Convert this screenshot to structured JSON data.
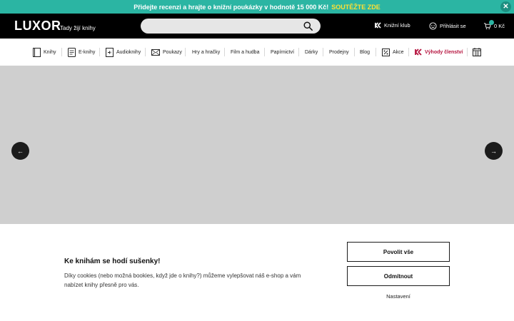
{
  "promo": {
    "text": "Přidejte recenzi a hrajte o knižní poukázky v hodnotě 15 000 Kč!",
    "highlight": "SOUTĚŽTE ZDE",
    "close_glyph": "✕"
  },
  "header": {
    "logo": "LUXOR",
    "tagline": "Tady žijí knihy",
    "search_placeholder": "",
    "club_label": "Knižní klub",
    "login_label": "Přihlásit se",
    "cart_label": "0 Kč"
  },
  "nav": {
    "items": [
      {
        "label": "Knihy",
        "icon": "book-icon"
      },
      {
        "label": "E-knihy",
        "icon": "ebook-icon"
      },
      {
        "label": "Audioknihy",
        "icon": "audiobook-icon"
      },
      {
        "label": "Poukazy",
        "icon": "voucher-icon"
      },
      {
        "label": "Hry a hračky"
      },
      {
        "label": "Film a hudba"
      },
      {
        "label": "Papírnictví"
      },
      {
        "label": "Dárky"
      },
      {
        "label": "Prodejny"
      },
      {
        "label": "Blog"
      },
      {
        "label": "Akce",
        "icon": "percent-icon"
      },
      {
        "label": "Výhody členství",
        "icon": "club-logo-icon"
      }
    ]
  },
  "carousel": {
    "prev_glyph": "←",
    "next_glyph": "→"
  },
  "cookie": {
    "title": "Ke knihám se hodí sušenky!",
    "text": "Díky cookies (nebo možná bookies, když jde o knihy?) můžeme vylepšovat náš e-shop a vám nabízet knihy přesně pro vás.",
    "allow_all": "Povolit vše",
    "reject": "Odmítnout",
    "settings": "Nastavení"
  },
  "colors": {
    "promo_bg": "#2bb5a3",
    "promo_highlight": "#ffe033",
    "header_bg": "#000000",
    "member_accent": "#b5133e",
    "carousel_bg": "#cfcfcf"
  }
}
